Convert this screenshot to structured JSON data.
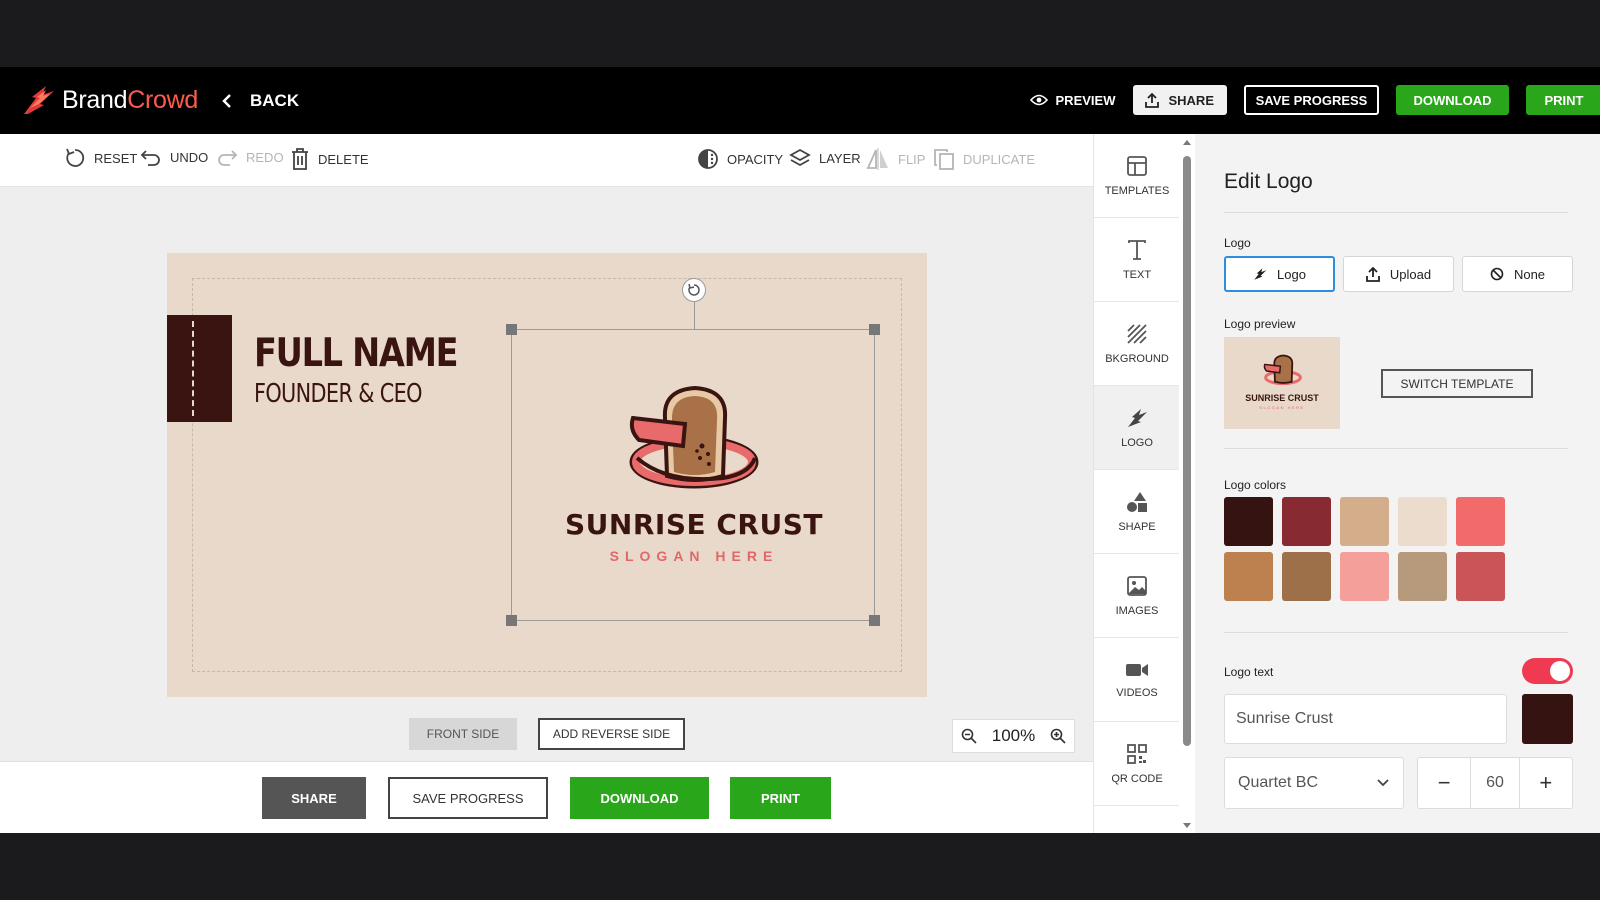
{
  "brand": {
    "name_part1": "Brand",
    "name_part2": "Crowd"
  },
  "header": {
    "back_label": "BACK",
    "preview_label": "PREVIEW",
    "share_label": "SHARE",
    "save_label": "SAVE PROGRESS",
    "download_label": "DOWNLOAD",
    "print_label": "PRINT"
  },
  "toolbar": {
    "reset": "RESET",
    "undo": "UNDO",
    "redo": "REDO",
    "delete": "DELETE",
    "opacity": "OPACITY",
    "layer": "LAYER",
    "flip": "FLIP",
    "duplicate": "DUPLICATE"
  },
  "card": {
    "full_name": "FULL NAME",
    "role": "FOUNDER & CEO",
    "logo_name": "SUNRISE CRUST",
    "logo_slogan": "SLOGAN HERE"
  },
  "canvas": {
    "front_side": "FRONT SIDE",
    "add_reverse": "ADD REVERSE SIDE",
    "zoom": "100%"
  },
  "bottom": {
    "share": "SHARE",
    "save": "SAVE PROGRESS",
    "download": "DOWNLOAD",
    "print": "PRINT"
  },
  "sidenav": {
    "items": [
      {
        "label": "TEMPLATES",
        "icon": "templates-icon"
      },
      {
        "label": "TEXT",
        "icon": "text-icon"
      },
      {
        "label": "BKGROUND",
        "icon": "background-icon"
      },
      {
        "label": "LOGO",
        "icon": "logo-icon",
        "active": true
      },
      {
        "label": "SHAPE",
        "icon": "shape-icon"
      },
      {
        "label": "IMAGES",
        "icon": "image-icon"
      },
      {
        "label": "VIDEOS",
        "icon": "video-icon"
      },
      {
        "label": "QR CODE",
        "icon": "qr-code-icon"
      }
    ]
  },
  "panel": {
    "title": "Edit Logo",
    "logo_label": "Logo",
    "options": [
      "Logo",
      "Upload",
      "None"
    ],
    "preview_label": "Logo preview",
    "preview_name": "SUNRISE CRUST",
    "preview_slogan": "SLOGAN HERE",
    "switch_template": "SWITCH TEMPLATE",
    "colors_label": "Logo colors",
    "colors": [
      "#341310",
      "#882a31",
      "#d4ae8a",
      "#ebdccd",
      "#f26a6a",
      "#bd8150",
      "#9d704a",
      "#f59f9a",
      "#b69a7b",
      "#c95559"
    ],
    "logo_text_label": "Logo text",
    "logo_text_value": "Sunrise Crust",
    "logo_text_enabled": true,
    "text_color": "#341310",
    "font": "Quartet BC",
    "font_size": "60"
  },
  "colors": {
    "accent_green": "#2aa61b",
    "toggle_red": "#f03a52",
    "active_blue": "#2d8de0",
    "card_bg": "#e8d9cb",
    "dark_brown": "#3a1410"
  }
}
